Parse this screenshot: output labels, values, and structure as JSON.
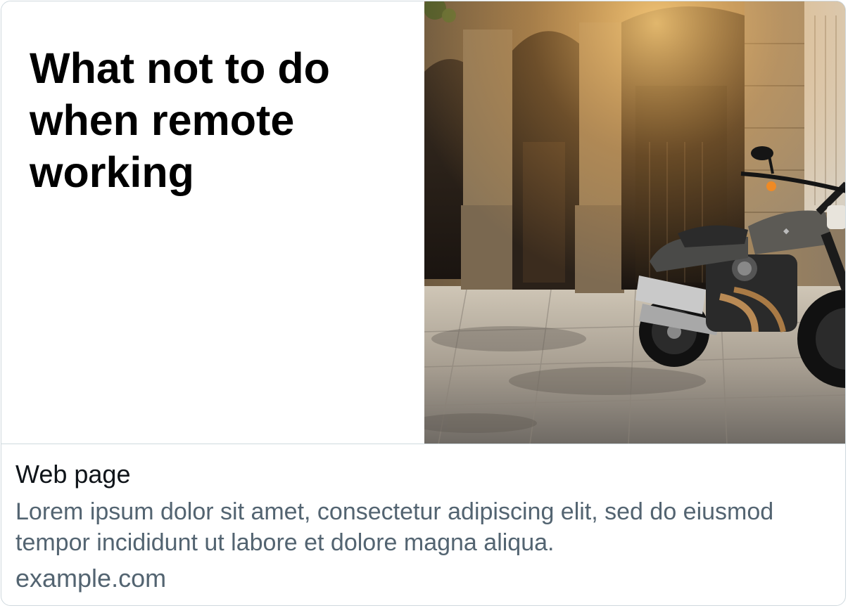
{
  "card": {
    "image_headline": "What not to do when remote working",
    "title": "Web page",
    "description": "Lorem ipsum dolor sit amet, consectetur adipiscing elit, sed do eiusmod tempor incididunt ut labore et dolore magna aliqua.",
    "domain": "example.com"
  },
  "colors": {
    "border": "#cfd9de",
    "title": "#0f1419",
    "secondary_text": "#536471",
    "headline": "#000000"
  }
}
